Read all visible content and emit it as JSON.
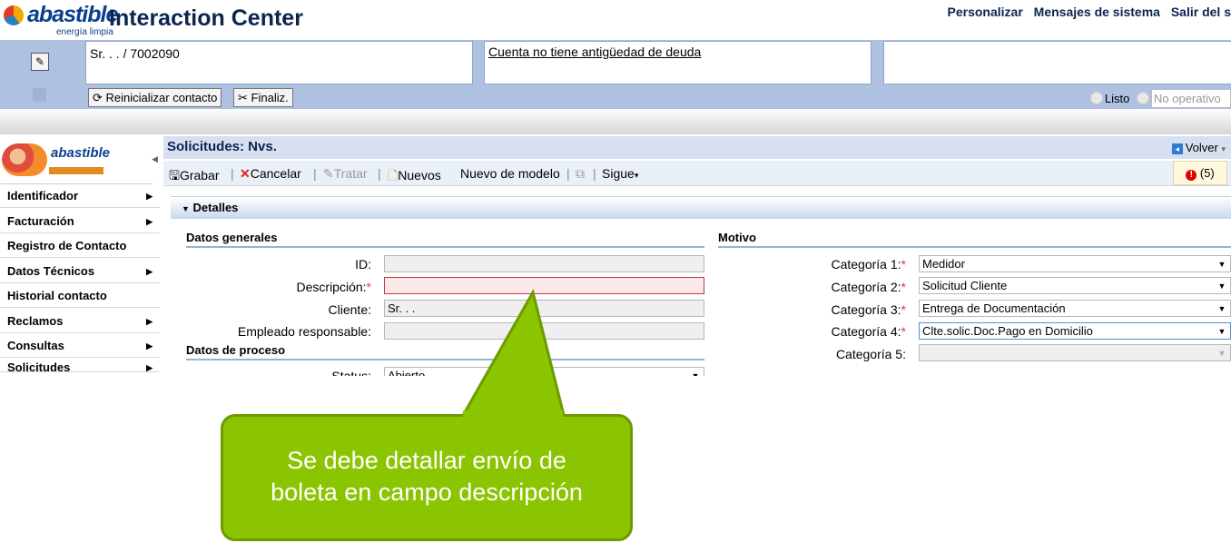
{
  "header": {
    "logo_text": "abastible",
    "logo_sub": "energía limpia",
    "app_title": "Interaction Center",
    "links": [
      "Personalizar",
      "Mensajes de sistema",
      "Salir del s"
    ]
  },
  "context": {
    "customer": "Sr. . . / 7002090",
    "debt_note": "Cuenta no tiene antigüedad de deuda",
    "buttons": {
      "reset": "Reinicializar contacto",
      "finish": "Finaliz."
    },
    "status": {
      "ready": "Listo",
      "not_operative": "No operativo"
    }
  },
  "nav": {
    "logo_word": "abastible",
    "items": [
      {
        "label": "Identificador",
        "has_arrow": true
      },
      {
        "label": "Facturación",
        "has_arrow": true
      },
      {
        "label": "Registro de Contacto",
        "has_arrow": false
      },
      {
        "label": "Datos Técnicos",
        "has_arrow": true
      },
      {
        "label": "Historial contacto",
        "has_arrow": false
      },
      {
        "label": "Reclamos",
        "has_arrow": true
      },
      {
        "label": "Consultas",
        "has_arrow": true
      },
      {
        "label": "Solicitudes",
        "has_arrow": true
      }
    ]
  },
  "page": {
    "title": "Solicitudes: Nvs.",
    "back": "Volver",
    "toolbar": {
      "save": "Grabar",
      "cancel": "Cancelar",
      "treat": "Tratar",
      "new": "Nuevos",
      "new_from_template": "Nuevo de modelo",
      "next": "Sigue"
    },
    "messages_count": "(5)",
    "details_title": "Detalles"
  },
  "general": {
    "section": "Datos generales",
    "id_label": "ID:",
    "id_value": "",
    "desc_label": "Descripción:",
    "desc_value": "",
    "client_label": "Cliente:",
    "client_value": "Sr. . .",
    "employee_label": "Empleado responsable:",
    "employee_value": ""
  },
  "process": {
    "section": "Datos de proceso",
    "status_label": "Status:",
    "status_value": "Abierto"
  },
  "motivo": {
    "section": "Motivo",
    "cat1_label": "Categoría 1:",
    "cat1_value": "Medidor",
    "cat2_label": "Categoría 2:",
    "cat2_value": "Solicitud Cliente",
    "cat3_label": "Categoría 3:",
    "cat3_value": "Entrega de Documentación",
    "cat4_label": "Categoría 4:",
    "cat4_value": "Clte.solic.Doc.Pago en Domicilio",
    "cat5_label": "Categoría 5:",
    "cat5_value": ""
  },
  "callout": {
    "line1": "Se debe detallar envío de",
    "line2": "boleta en campo descripción",
    "color": "#8bc400"
  }
}
